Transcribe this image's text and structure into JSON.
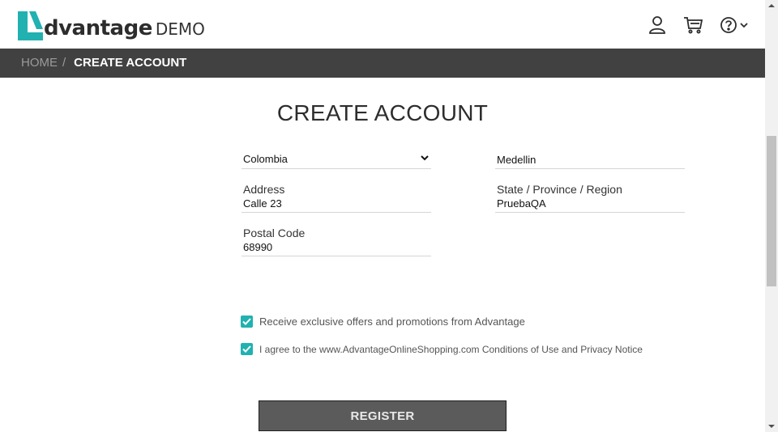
{
  "header": {
    "logo_word": "dvantage",
    "logo_demo": "DEMO",
    "icons": [
      "user-icon",
      "cart-icon",
      "help-icon",
      "chevron-down-icon"
    ]
  },
  "breadcrumb": {
    "home": "HOME",
    "separator": "/",
    "current": "CREATE ACCOUNT"
  },
  "title": "CREATE ACCOUNT",
  "form": {
    "country": {
      "value": "Colombia"
    },
    "city": {
      "value": "Medellin"
    },
    "address": {
      "label": "Address",
      "value": "Calle 23"
    },
    "state": {
      "label": "State / Province / Region",
      "value": "PruebaQA"
    },
    "postal": {
      "label": "Postal Code",
      "value": "68990"
    }
  },
  "checks": {
    "offers": {
      "label": "Receive exclusive offers and promotions from Advantage",
      "checked": true
    },
    "agree": {
      "label": "I agree to the www.AdvantageOnlineShopping.com Conditions of Use and Privacy Notice",
      "checked": true
    }
  },
  "register_label": "REGISTER",
  "colors": {
    "accent": "#21b1b1",
    "bar": "#414141",
    "button": "#5b5b5b"
  }
}
